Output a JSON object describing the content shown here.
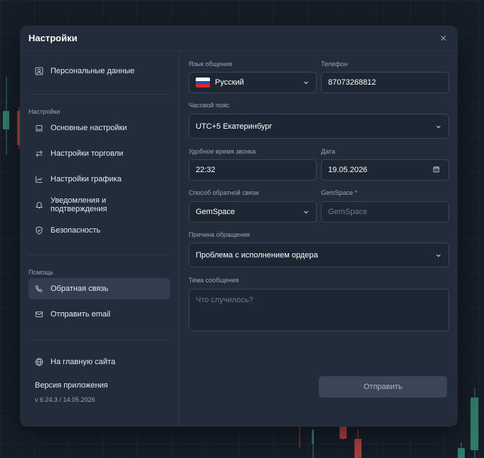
{
  "modal": {
    "title": "Настройки"
  },
  "sidebar": {
    "personal": "Персональные данные",
    "settings_section": "Настройки",
    "items": [
      {
        "label": "Основные настройки",
        "icon": "laptop-icon"
      },
      {
        "label": "Настройки торговли",
        "icon": "arrows-swap-icon"
      },
      {
        "label": "Настройки графика",
        "icon": "chart-line-icon"
      },
      {
        "label": "Уведомления и подтверждения",
        "icon": "bell-icon"
      },
      {
        "label": "Безопасность",
        "icon": "shield-icon"
      }
    ],
    "help_section": "Помощь",
    "feedback": "Обратная связь",
    "email": "Отправить email",
    "home": "На главную сайта",
    "version_title": "Версия приложения",
    "version_value": "v 6.24.3 / 14.05.2026"
  },
  "form": {
    "language": {
      "label": "Язык общения",
      "value": "Русский"
    },
    "phone": {
      "label": "Телефон",
      "value": "87073268812"
    },
    "timezone": {
      "label": "Часовой пояс",
      "value": "UTC+5 Екатеринбург"
    },
    "call_time": {
      "label": "Удобное время звонка",
      "value": "22:32"
    },
    "date": {
      "label": "Дата",
      "value": "19.05.2026"
    },
    "feedback_method": {
      "label": "Способ обратной связи",
      "value": "GemSpace"
    },
    "gemspace": {
      "label": "GemSpace *",
      "placeholder": "GemSpace"
    },
    "reason": {
      "label": "Причина обращения",
      "value": "Проблема с исполнением ордера"
    },
    "subject": {
      "label": "Тема сообщения",
      "placeholder": "Что случилось?"
    },
    "submit": "Отправить"
  },
  "colors": {
    "modal_bg": "#222c3a",
    "page_bg": "#161d27",
    "candle_up": "#2f7d6a",
    "candle_down": "#a93d43"
  }
}
